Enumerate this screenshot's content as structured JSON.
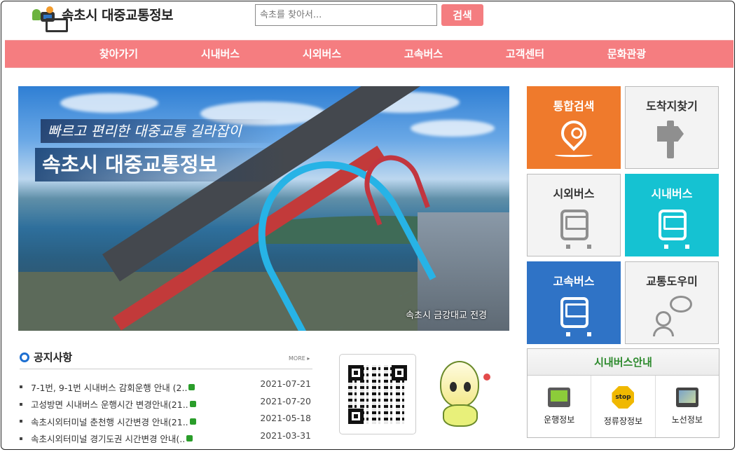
{
  "header": {
    "site_title": "속초시 대중교통정보",
    "search_placeholder": "속초를 찾아서...",
    "search_button": "검색"
  },
  "nav": {
    "items": [
      "찾아가기",
      "시내버스",
      "시외버스",
      "고속버스",
      "고객센터",
      "문화관광"
    ]
  },
  "banner": {
    "tagline": "빠르고 편리한 대중교통 길라잡이",
    "headline": "속초시 대중교통정보",
    "caption": "속초시 금강대교 전경"
  },
  "notices": {
    "title": "공지사항",
    "more": "MORE ▸",
    "items": [
      {
        "title": "7-1번, 9-1번 시내버스 감회운행 안내 (2..",
        "date": "2021-07-21"
      },
      {
        "title": "고성방면 시내버스 운행시간 변경안내(21..",
        "date": "2021-07-20"
      },
      {
        "title": "속초시외터미널 춘천행 시간변경 안내(21..",
        "date": "2021-05-18"
      },
      {
        "title": "속초시외터미널 경기도권 시간변경 안내(..",
        "date": "2021-03-31"
      }
    ]
  },
  "tiles": {
    "integrated_search": "통합검색",
    "find_destination": "도착지찾기",
    "intercity_bus": "시외버스",
    "city_bus": "시내버스",
    "express_bus": "고속버스",
    "transit_help": "교통도우미"
  },
  "bus_info": {
    "title": "시내버스안내",
    "operation": "운행정보",
    "stops": "정류장정보",
    "routes": "노선정보",
    "stop_sign_text": "stop"
  },
  "colors": {
    "nav": "#f57d80",
    "tile_orange": "#ef7a2c",
    "tile_cyan": "#15c2d2",
    "tile_blue": "#2f73c6",
    "bus_info_title": "#2d8a2d"
  }
}
